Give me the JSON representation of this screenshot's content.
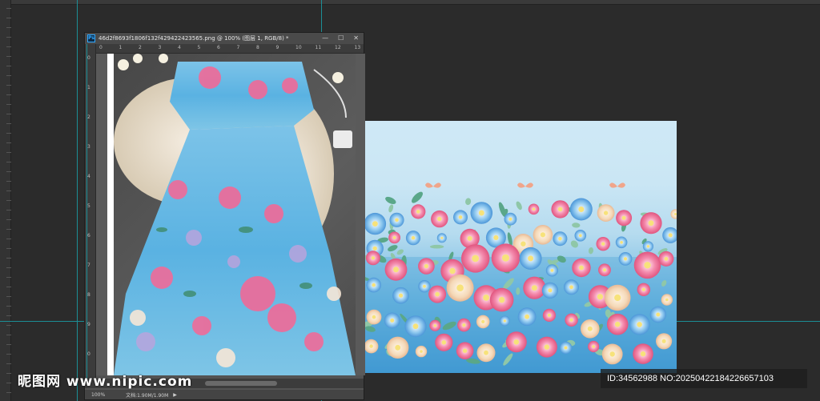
{
  "document": {
    "title": "46d2f8693f1806f132f429422423565.png @ 100% (图层 1, RGB/8) *",
    "app_badge": "Ps",
    "controls": {
      "minimize": "—",
      "restore": "☐",
      "close": "✕"
    }
  },
  "ruler": {
    "h_ticks": [
      "0",
      "1",
      "2",
      "3",
      "4",
      "5",
      "6",
      "7",
      "8",
      "9",
      "10",
      "11",
      "12",
      "13"
    ],
    "v_ticks": [
      "0",
      "1",
      "2",
      "3",
      "4",
      "5",
      "6",
      "7",
      "8",
      "9",
      "0"
    ]
  },
  "status": {
    "zoom": "100%",
    "doc_size": "文档:1.90M/1.90M",
    "arrow": "▶"
  },
  "watermark": {
    "logo": "昵图网 www.nipic.com",
    "id_text": "ID:34562988 NO:20250422184226657103"
  },
  "colors": {
    "guide": "#1c8e96",
    "workspace": "#2b2b2b",
    "ps_blue": "#31a8ff"
  }
}
